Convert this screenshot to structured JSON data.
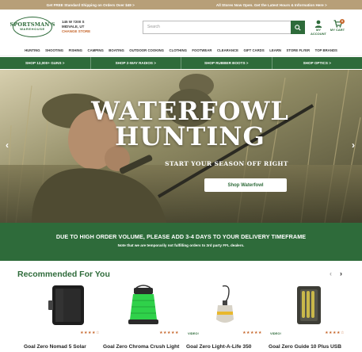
{
  "topbar": {
    "left": "Get FREE Standard Shipping on Orders Over $49 >",
    "right": "All Stores Now Open. Get the Latest Hours & Information Here >"
  },
  "logo": {
    "line1": "SPORTSMAN'S",
    "line2": "WAREHOUSE"
  },
  "store": {
    "address": "145 W 7200 S",
    "city": "MIDVALE, UT",
    "change": "CHANGE STORE"
  },
  "search": {
    "placeholder": "Search"
  },
  "header": {
    "account": "MY ACCOUNT",
    "cart": "MY CART",
    "cart_count": "0"
  },
  "nav": [
    "HUNTING",
    "SHOOTING",
    "FISHING",
    "CAMPING",
    "BOATING",
    "OUTDOOR COOKING",
    "CLOTHING",
    "FOOTWEAR",
    "CLEARANCE",
    "GIFT CARDS",
    "LEARN",
    "STORE FLYER",
    "TOP BRANDS"
  ],
  "promo": [
    "SHOP 12,000+ GUNS >",
    "SHOP 2-WAY RADIOS >",
    "SHOP RUBBER BOOTS >",
    "SHOP OPTICS >"
  ],
  "hero": {
    "title_line1": "WATERFOWL",
    "title_line2": "HUNTING",
    "subtitle": "START YOUR SEASON OFF RIGHT",
    "cta": "Shop Waterfowl",
    "prev": "‹",
    "next": "›"
  },
  "notice": {
    "headline": "DUE TO HIGH ORDER VOLUME, PLEASE ADD 3-4 DAYS TO YOUR DELIVERY TIMEFRAME",
    "detail": "Note that we are temporarily not fulfilling orders to 3rd party FFL dealers."
  },
  "recommended": {
    "title": "Recommended For You",
    "prev": "‹",
    "next": "›",
    "products": [
      {
        "name": "Goal Zero Nomad 5 Solar",
        "stars": "★★★★☆",
        "video": "",
        "icon": "solar-panel-icon"
      },
      {
        "name": "Goal Zero Chroma Crush Light",
        "stars": "★★★★★",
        "video": "",
        "icon": "lantern-icon"
      },
      {
        "name": "Goal Zero Light-A-Life 350",
        "stars": "★★★★★",
        "video": "VIDEO!",
        "icon": "light-bulb-icon"
      },
      {
        "name": "Goal Zero Guide 10 Plus USB",
        "stars": "★★★★☆",
        "video": "VIDEO!",
        "icon": "battery-pack-icon"
      }
    ]
  },
  "colors": {
    "brand_green": "#2e6b3a",
    "topbar_tan": "#b79f78",
    "accent_orange": "#c6662b"
  }
}
